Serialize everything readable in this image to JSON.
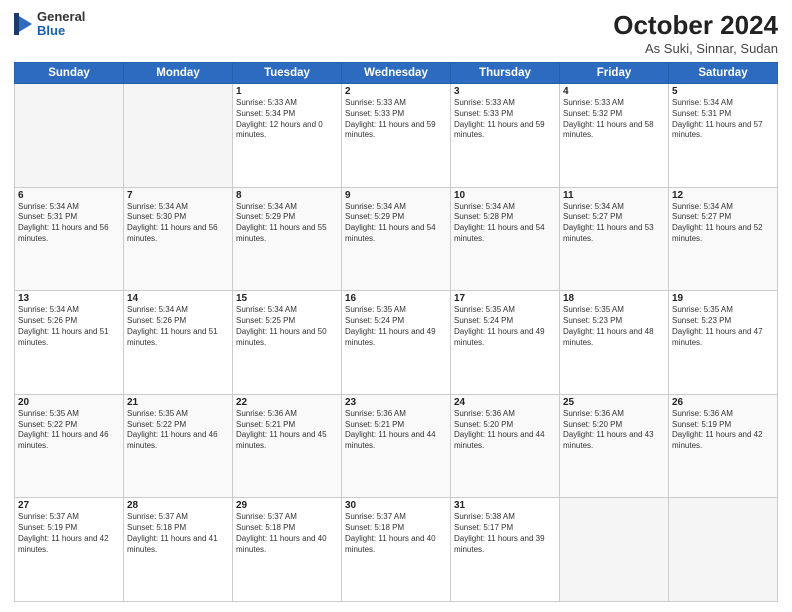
{
  "header": {
    "logo": {
      "general": "General",
      "blue": "Blue",
      "icon": "▶"
    },
    "title": "October 2024",
    "subtitle": "As Suki, Sinnar, Sudan"
  },
  "days_of_week": [
    "Sunday",
    "Monday",
    "Tuesday",
    "Wednesday",
    "Thursday",
    "Friday",
    "Saturday"
  ],
  "weeks": [
    [
      {
        "day": "",
        "empty": true
      },
      {
        "day": "",
        "empty": true
      },
      {
        "day": "1",
        "sunrise": "Sunrise: 5:33 AM",
        "sunset": "Sunset: 5:34 PM",
        "daylight": "Daylight: 12 hours and 0 minutes."
      },
      {
        "day": "2",
        "sunrise": "Sunrise: 5:33 AM",
        "sunset": "Sunset: 5:33 PM",
        "daylight": "Daylight: 11 hours and 59 minutes."
      },
      {
        "day": "3",
        "sunrise": "Sunrise: 5:33 AM",
        "sunset": "Sunset: 5:33 PM",
        "daylight": "Daylight: 11 hours and 59 minutes."
      },
      {
        "day": "4",
        "sunrise": "Sunrise: 5:33 AM",
        "sunset": "Sunset: 5:32 PM",
        "daylight": "Daylight: 11 hours and 58 minutes."
      },
      {
        "day": "5",
        "sunrise": "Sunrise: 5:34 AM",
        "sunset": "Sunset: 5:31 PM",
        "daylight": "Daylight: 11 hours and 57 minutes."
      }
    ],
    [
      {
        "day": "6",
        "sunrise": "Sunrise: 5:34 AM",
        "sunset": "Sunset: 5:31 PM",
        "daylight": "Daylight: 11 hours and 56 minutes."
      },
      {
        "day": "7",
        "sunrise": "Sunrise: 5:34 AM",
        "sunset": "Sunset: 5:30 PM",
        "daylight": "Daylight: 11 hours and 56 minutes."
      },
      {
        "day": "8",
        "sunrise": "Sunrise: 5:34 AM",
        "sunset": "Sunset: 5:29 PM",
        "daylight": "Daylight: 11 hours and 55 minutes."
      },
      {
        "day": "9",
        "sunrise": "Sunrise: 5:34 AM",
        "sunset": "Sunset: 5:29 PM",
        "daylight": "Daylight: 11 hours and 54 minutes."
      },
      {
        "day": "10",
        "sunrise": "Sunrise: 5:34 AM",
        "sunset": "Sunset: 5:28 PM",
        "daylight": "Daylight: 11 hours and 54 minutes."
      },
      {
        "day": "11",
        "sunrise": "Sunrise: 5:34 AM",
        "sunset": "Sunset: 5:27 PM",
        "daylight": "Daylight: 11 hours and 53 minutes."
      },
      {
        "day": "12",
        "sunrise": "Sunrise: 5:34 AM",
        "sunset": "Sunset: 5:27 PM",
        "daylight": "Daylight: 11 hours and 52 minutes."
      }
    ],
    [
      {
        "day": "13",
        "sunrise": "Sunrise: 5:34 AM",
        "sunset": "Sunset: 5:26 PM",
        "daylight": "Daylight: 11 hours and 51 minutes."
      },
      {
        "day": "14",
        "sunrise": "Sunrise: 5:34 AM",
        "sunset": "Sunset: 5:26 PM",
        "daylight": "Daylight: 11 hours and 51 minutes."
      },
      {
        "day": "15",
        "sunrise": "Sunrise: 5:34 AM",
        "sunset": "Sunset: 5:25 PM",
        "daylight": "Daylight: 11 hours and 50 minutes."
      },
      {
        "day": "16",
        "sunrise": "Sunrise: 5:35 AM",
        "sunset": "Sunset: 5:24 PM",
        "daylight": "Daylight: 11 hours and 49 minutes."
      },
      {
        "day": "17",
        "sunrise": "Sunrise: 5:35 AM",
        "sunset": "Sunset: 5:24 PM",
        "daylight": "Daylight: 11 hours and 49 minutes."
      },
      {
        "day": "18",
        "sunrise": "Sunrise: 5:35 AM",
        "sunset": "Sunset: 5:23 PM",
        "daylight": "Daylight: 11 hours and 48 minutes."
      },
      {
        "day": "19",
        "sunrise": "Sunrise: 5:35 AM",
        "sunset": "Sunset: 5:23 PM",
        "daylight": "Daylight: 11 hours and 47 minutes."
      }
    ],
    [
      {
        "day": "20",
        "sunrise": "Sunrise: 5:35 AM",
        "sunset": "Sunset: 5:22 PM",
        "daylight": "Daylight: 11 hours and 46 minutes."
      },
      {
        "day": "21",
        "sunrise": "Sunrise: 5:35 AM",
        "sunset": "Sunset: 5:22 PM",
        "daylight": "Daylight: 11 hours and 46 minutes."
      },
      {
        "day": "22",
        "sunrise": "Sunrise: 5:36 AM",
        "sunset": "Sunset: 5:21 PM",
        "daylight": "Daylight: 11 hours and 45 minutes."
      },
      {
        "day": "23",
        "sunrise": "Sunrise: 5:36 AM",
        "sunset": "Sunset: 5:21 PM",
        "daylight": "Daylight: 11 hours and 44 minutes."
      },
      {
        "day": "24",
        "sunrise": "Sunrise: 5:36 AM",
        "sunset": "Sunset: 5:20 PM",
        "daylight": "Daylight: 11 hours and 44 minutes."
      },
      {
        "day": "25",
        "sunrise": "Sunrise: 5:36 AM",
        "sunset": "Sunset: 5:20 PM",
        "daylight": "Daylight: 11 hours and 43 minutes."
      },
      {
        "day": "26",
        "sunrise": "Sunrise: 5:36 AM",
        "sunset": "Sunset: 5:19 PM",
        "daylight": "Daylight: 11 hours and 42 minutes."
      }
    ],
    [
      {
        "day": "27",
        "sunrise": "Sunrise: 5:37 AM",
        "sunset": "Sunset: 5:19 PM",
        "daylight": "Daylight: 11 hours and 42 minutes."
      },
      {
        "day": "28",
        "sunrise": "Sunrise: 5:37 AM",
        "sunset": "Sunset: 5:18 PM",
        "daylight": "Daylight: 11 hours and 41 minutes."
      },
      {
        "day": "29",
        "sunrise": "Sunrise: 5:37 AM",
        "sunset": "Sunset: 5:18 PM",
        "daylight": "Daylight: 11 hours and 40 minutes."
      },
      {
        "day": "30",
        "sunrise": "Sunrise: 5:37 AM",
        "sunset": "Sunset: 5:18 PM",
        "daylight": "Daylight: 11 hours and 40 minutes."
      },
      {
        "day": "31",
        "sunrise": "Sunrise: 5:38 AM",
        "sunset": "Sunset: 5:17 PM",
        "daylight": "Daylight: 11 hours and 39 minutes."
      },
      {
        "day": "",
        "empty": true
      },
      {
        "day": "",
        "empty": true
      }
    ]
  ]
}
